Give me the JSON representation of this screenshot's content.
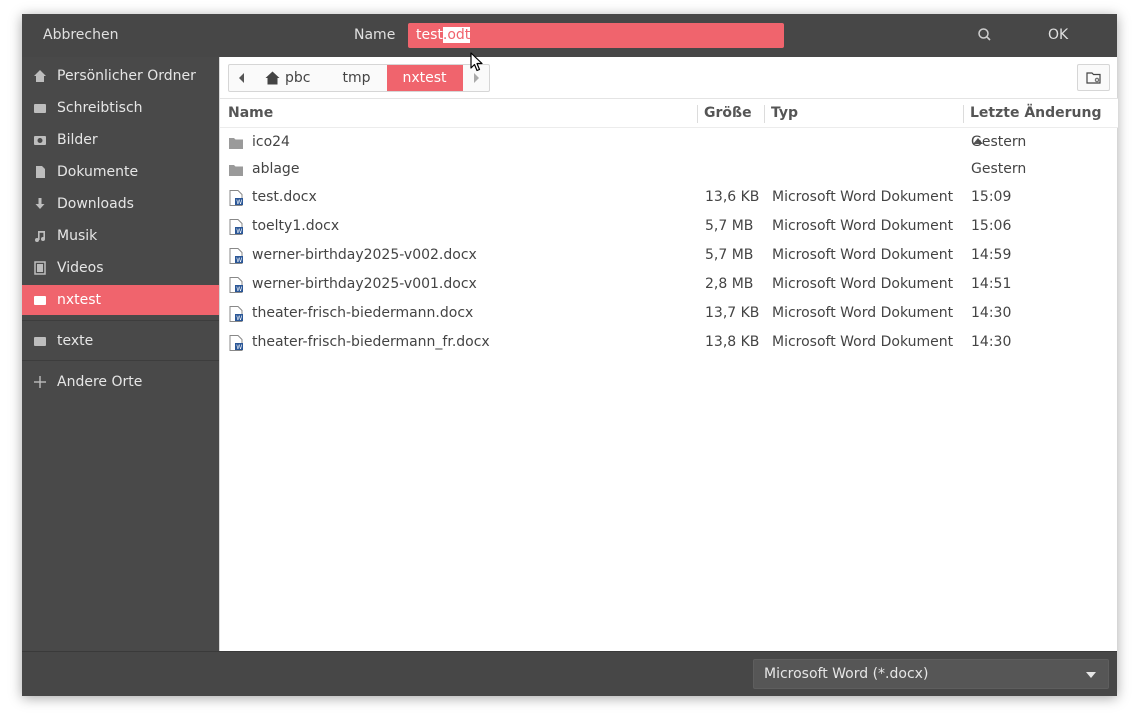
{
  "header": {
    "cancel_label": "Abbrechen",
    "name_label": "Name",
    "filename_base": "test",
    "filename_selected": ".odt",
    "ok_label": "OK"
  },
  "sidebar": {
    "items": [
      {
        "label": "Persönlicher Ordner",
        "icon": "home-icon"
      },
      {
        "label": "Schreibtisch",
        "icon": "folder-icon"
      },
      {
        "label": "Bilder",
        "icon": "camera-icon"
      },
      {
        "label": "Dokumente",
        "icon": "document-icon"
      },
      {
        "label": "Downloads",
        "icon": "download-icon"
      },
      {
        "label": "Musik",
        "icon": "music-icon"
      },
      {
        "label": "Videos",
        "icon": "film-icon"
      },
      {
        "label": "nxtest",
        "icon": "folder-icon",
        "active": true
      },
      {
        "label": "texte",
        "icon": "folder-icon"
      },
      {
        "label": "Andere Orte",
        "icon": "plus-icon"
      }
    ]
  },
  "pathbar": {
    "segments": [
      "pbc",
      "tmp",
      "nxtest"
    ],
    "active": "nxtest"
  },
  "columns": {
    "name": "Name",
    "size": "Größe",
    "type": "Typ",
    "modified": "Letzte Änderung"
  },
  "files": [
    {
      "name": "ico24",
      "size": "",
      "type": "",
      "modified": "Gestern",
      "kind": "folder"
    },
    {
      "name": "ablage",
      "size": "",
      "type": "",
      "modified": "Gestern",
      "kind": "folder"
    },
    {
      "name": "test.docx",
      "size": "13,6 KB",
      "type": "Microsoft Word Dokument",
      "modified": "15:09",
      "kind": "word"
    },
    {
      "name": "toelty1.docx",
      "size": "5,7 MB",
      "type": "Microsoft Word Dokument",
      "modified": "15:06",
      "kind": "word"
    },
    {
      "name": "werner-birthday2025-v002.docx",
      "size": "5,7 MB",
      "type": "Microsoft Word Dokument",
      "modified": "14:59",
      "kind": "word"
    },
    {
      "name": "werner-birthday2025-v001.docx",
      "size": "2,8 MB",
      "type": "Microsoft Word Dokument",
      "modified": "14:51",
      "kind": "word"
    },
    {
      "name": "theater-frisch-biedermann.docx",
      "size": "13,7 KB",
      "type": "Microsoft Word Dokument",
      "modified": "14:30",
      "kind": "word"
    },
    {
      "name": "theater-frisch-biedermann_fr.docx",
      "size": "13,8 KB",
      "type": "Microsoft Word Dokument",
      "modified": "14:30",
      "kind": "word"
    }
  ],
  "footer": {
    "filter_value": "Microsoft Word (*.docx)"
  },
  "colors": {
    "accent": "#f0646d",
    "header_bg": "#474747",
    "sidebar_bg": "#494949"
  }
}
